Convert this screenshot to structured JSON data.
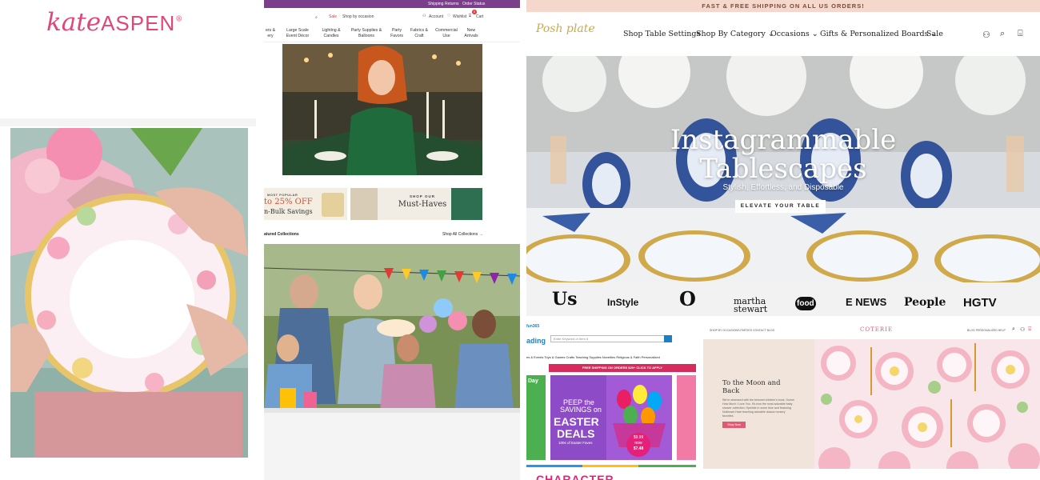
{
  "collage": {
    "kate_aspen": {
      "logo_script": "kate",
      "logo_caps": "ASPEN",
      "logo_reg": "®"
    },
    "party_store": {
      "topbar": {
        "shipping": "Shipping",
        "returns": "Returns",
        "order_status": "Order Status"
      },
      "header": {
        "sale": "Sale",
        "shop_by_occasion": "Shop by occasion",
        "account": "Account",
        "wishlist": "Wishlist",
        "cart": "Cart",
        "cart_count": "0"
      },
      "nav": [
        {
          "line1": "ers &",
          "line2": "ery"
        },
        {
          "line1": "Large Scale",
          "line2": "Event Décor"
        },
        {
          "line1": "Lighting &",
          "line2": "Candles"
        },
        {
          "line1": "Party Supplies &",
          "line2": "Balloons"
        },
        {
          "line1": "Party",
          "line2": "Favors"
        },
        {
          "line1": "Fabrics &",
          "line2": "Craft"
        },
        {
          "line1": "Commercial",
          "line2": "Use"
        },
        {
          "line1": "New",
          "line2": "Arrivals"
        }
      ],
      "promo1": {
        "kicker": "MOST POPULAR",
        "offer": "to 25% OFF",
        "sub": "n-Bulk Savings"
      },
      "promo2": {
        "kicker": "SHOP OUR",
        "title": "Must-Haves"
      },
      "featured": {
        "label": "atured Collections",
        "link": "Shop All Collections →"
      }
    },
    "posh_plate": {
      "shipping_banner": "FAST & FREE SHIPPING ON ALL US ORDERS!",
      "brand": "Posh plate",
      "menu": [
        {
          "label": "Shop Table Settings"
        },
        {
          "label": "Shop By Category ⌄"
        },
        {
          "label": "Occasions ⌄"
        },
        {
          "label": "Gifts & Personalized Boards ⌄"
        },
        {
          "label": "Sale"
        }
      ],
      "hero_title_line1": "Instagrammable",
      "hero_title_line2": "Tablescapes",
      "hero_subtitle": "Stylish, Effortless, and Disposable",
      "hero_cta": "ELEVATE YOUR TABLE",
      "press_logos": [
        {
          "name": "Us",
          "font": "serif"
        },
        {
          "name": "InStyle",
          "font": "sans"
        },
        {
          "name": "O",
          "font": "serif"
        },
        {
          "name": "martha stewart",
          "font": "serif"
        },
        {
          "name": "food",
          "font": "sans"
        },
        {
          "name": "E NEWS",
          "font": "sans"
        },
        {
          "name": "People",
          "font": "serif"
        },
        {
          "name": "HGTV",
          "font": "sans"
        }
      ]
    },
    "fun365": {
      "logo_small": "fun365",
      "logo_text": "ading",
      "search_placeholder": "Enter Keyword or Item #",
      "categories": "es & Events   Toys & Games   Crafts   Teaching Supplies   Novelties   Religious & Faith   Personalized",
      "free_shipping": "FREE SHIPPING ON ORDERS $29+   CLICK TO APPLY",
      "tile1_text": "Day",
      "promo_line1": "PEEP the",
      "promo_line2": "SAVINGS on",
      "promo_line3": "EASTER",
      "promo_line4": "DEALS",
      "promo_line5": "100s of Easter Faves",
      "price_label": "$9.99",
      "price_now": "now",
      "price_new": "$7.48",
      "bottom_text": "CHARACTER"
    },
    "coterie": {
      "brand": "COTERIE",
      "nav_left": "SHOP BY    OCCASIONS    PARTIES    CONTACT    BLOG",
      "nav_right": "BLOG   PERSONALIZED   HELP",
      "heading_line1": "To the Moon and",
      "heading_line2": "Back",
      "body": "We're obsessed with the beloved children's book, Guess How Much I Love You. It's now the most adorable baby shower collection. Sprinkle in some blue and featuring Nutbrown Hare teaching adorable classic nursery favorites.",
      "button": "Shop Now"
    }
  }
}
